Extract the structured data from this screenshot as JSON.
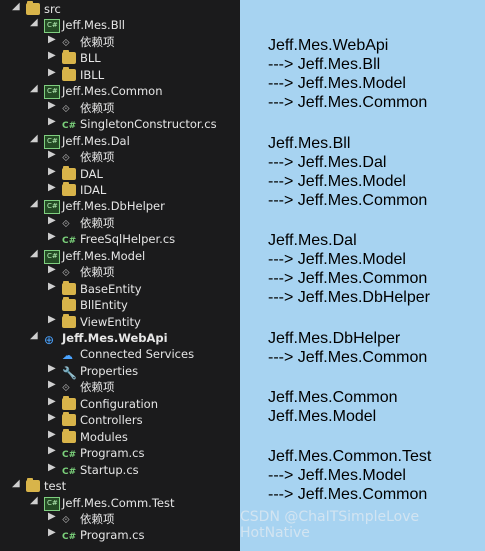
{
  "tree": {
    "items": [
      {
        "key": "src",
        "label": "src",
        "type": "folder",
        "indent": 0,
        "chev": "◢",
        "bold": false
      },
      {
        "key": "bll_proj",
        "label": "Jeff.Mes.Bll",
        "type": "proj",
        "indent": 1,
        "chev": "◢",
        "bold": false
      },
      {
        "key": "bll_deps",
        "label": "依赖项",
        "type": "deps",
        "indent": 2,
        "chev": "▶",
        "bold": false
      },
      {
        "key": "bll_folder",
        "label": "BLL",
        "type": "folder",
        "indent": 2,
        "chev": "▶",
        "bold": false
      },
      {
        "key": "ibll_folder",
        "label": "IBLL",
        "type": "folder",
        "indent": 2,
        "chev": "▶",
        "bold": false
      },
      {
        "key": "common_proj",
        "label": "Jeff.Mes.Common",
        "type": "proj",
        "indent": 1,
        "chev": "◢",
        "bold": false
      },
      {
        "key": "common_deps",
        "label": "依赖项",
        "type": "deps",
        "indent": 2,
        "chev": "▶",
        "bold": false
      },
      {
        "key": "singleton_cs",
        "label": "SingletonConstructor.cs",
        "type": "cs",
        "indent": 2,
        "chev": "▶",
        "bold": false
      },
      {
        "key": "dal_proj",
        "label": "Jeff.Mes.Dal",
        "type": "proj",
        "indent": 1,
        "chev": "◢",
        "bold": false
      },
      {
        "key": "dal_deps",
        "label": "依赖项",
        "type": "deps",
        "indent": 2,
        "chev": "▶",
        "bold": false
      },
      {
        "key": "dal_folder",
        "label": "DAL",
        "type": "folder",
        "indent": 2,
        "chev": "▶",
        "bold": false
      },
      {
        "key": "idal_folder",
        "label": "IDAL",
        "type": "folder",
        "indent": 2,
        "chev": "▶",
        "bold": false
      },
      {
        "key": "dbhelper_proj",
        "label": "Jeff.Mes.DbHelper",
        "type": "proj",
        "indent": 1,
        "chev": "◢",
        "bold": false
      },
      {
        "key": "dbhelper_deps",
        "label": "依赖项",
        "type": "deps",
        "indent": 2,
        "chev": "▶",
        "bold": false
      },
      {
        "key": "freesql_cs",
        "label": "FreeSqlHelper.cs",
        "type": "cs",
        "indent": 2,
        "chev": "▶",
        "bold": false
      },
      {
        "key": "model_proj",
        "label": "Jeff.Mes.Model",
        "type": "proj",
        "indent": 1,
        "chev": "◢",
        "bold": false
      },
      {
        "key": "model_deps",
        "label": "依赖项",
        "type": "deps",
        "indent": 2,
        "chev": "▶",
        "bold": false
      },
      {
        "key": "baseentity_folder",
        "label": "BaseEntity",
        "type": "folder",
        "indent": 2,
        "chev": "▶",
        "bold": false
      },
      {
        "key": "bllentity_folder",
        "label": "BllEntity",
        "type": "folder",
        "indent": 2,
        "chev": "",
        "bold": false
      },
      {
        "key": "viewentity_folder",
        "label": "ViewEntity",
        "type": "folder",
        "indent": 2,
        "chev": "▶",
        "bold": false
      },
      {
        "key": "webapi_proj",
        "label": "Jeff.Mes.WebApi",
        "type": "globe",
        "indent": 1,
        "chev": "◢",
        "bold": true
      },
      {
        "key": "connected_services",
        "label": "Connected Services",
        "type": "cloud",
        "indent": 2,
        "chev": "",
        "bold": false
      },
      {
        "key": "properties",
        "label": "Properties",
        "type": "wrench",
        "indent": 2,
        "chev": "▶",
        "bold": false
      },
      {
        "key": "webapi_deps",
        "label": "依赖项",
        "type": "deps",
        "indent": 2,
        "chev": "▶",
        "bold": false
      },
      {
        "key": "configuration_folder",
        "label": "Configuration",
        "type": "folder",
        "indent": 2,
        "chev": "▶",
        "bold": false
      },
      {
        "key": "controllers_folder",
        "label": "Controllers",
        "type": "folder",
        "indent": 2,
        "chev": "▶",
        "bold": false
      },
      {
        "key": "modules_folder",
        "label": "Modules",
        "type": "folder",
        "indent": 2,
        "chev": "▶",
        "bold": false
      },
      {
        "key": "program_cs",
        "label": "Program.cs",
        "type": "cs",
        "indent": 2,
        "chev": "▶",
        "bold": false
      },
      {
        "key": "startup_cs",
        "label": "Startup.cs",
        "type": "cs",
        "indent": 2,
        "chev": "▶",
        "bold": false
      },
      {
        "key": "test",
        "label": "test",
        "type": "folder",
        "indent": 0,
        "chev": "◢",
        "bold": false
      },
      {
        "key": "commtest_proj",
        "label": "Jeff.Mes.Comm.Test",
        "type": "proj",
        "indent": 1,
        "chev": "◢",
        "bold": false
      },
      {
        "key": "commtest_deps",
        "label": "依赖项",
        "type": "deps",
        "indent": 2,
        "chev": "▶",
        "bold": false
      },
      {
        "key": "commtest_program_cs",
        "label": "Program.cs",
        "type": "cs",
        "indent": 2,
        "chev": "▶",
        "bold": false
      }
    ]
  },
  "notes": {
    "lines": [
      "Jeff.Mes.WebApi",
      "---> Jeff.Mes.Bll",
      "---> Jeff.Mes.Model",
      "---> Jeff.Mes.Common",
      "Jeff.Mes.Bll",
      "---> Jeff.Mes.Dal",
      "---> Jeff.Mes.Model",
      "---> Jeff.Mes.Common",
      "Jeff.Mes.Dal",
      "---> Jeff.Mes.Model",
      "---> Jeff.Mes.Common",
      "---> Jeff.Mes.DbHelper",
      "Jeff.Mes.DbHelper",
      "---> Jeff.Mes.Common",
      "Jeff.Mes.Common",
      "Jeff.Mes.Model",
      "Jeff.Mes.Common.Test",
      "---> Jeff.Mes.Model",
      "---> Jeff.Mes.Common"
    ]
  },
  "watermark": "CSDN @ChaITSimpleLove HotNative"
}
